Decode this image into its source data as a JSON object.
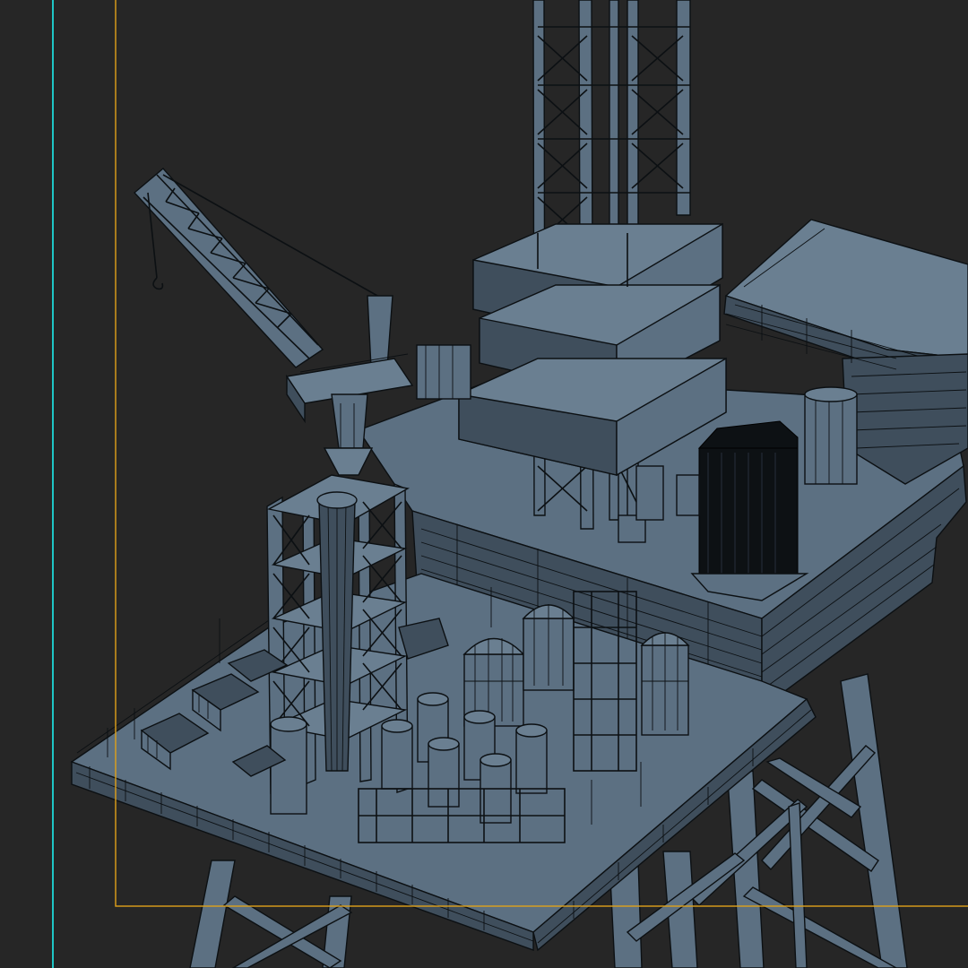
{
  "viewport": {
    "background": "#262626",
    "mesh_color": "#5c7082",
    "wire_color": "#0c1013"
  },
  "guides": {
    "safe_frame_color": "#e0a21a",
    "boundary_line_color": "#1fc6c6"
  }
}
